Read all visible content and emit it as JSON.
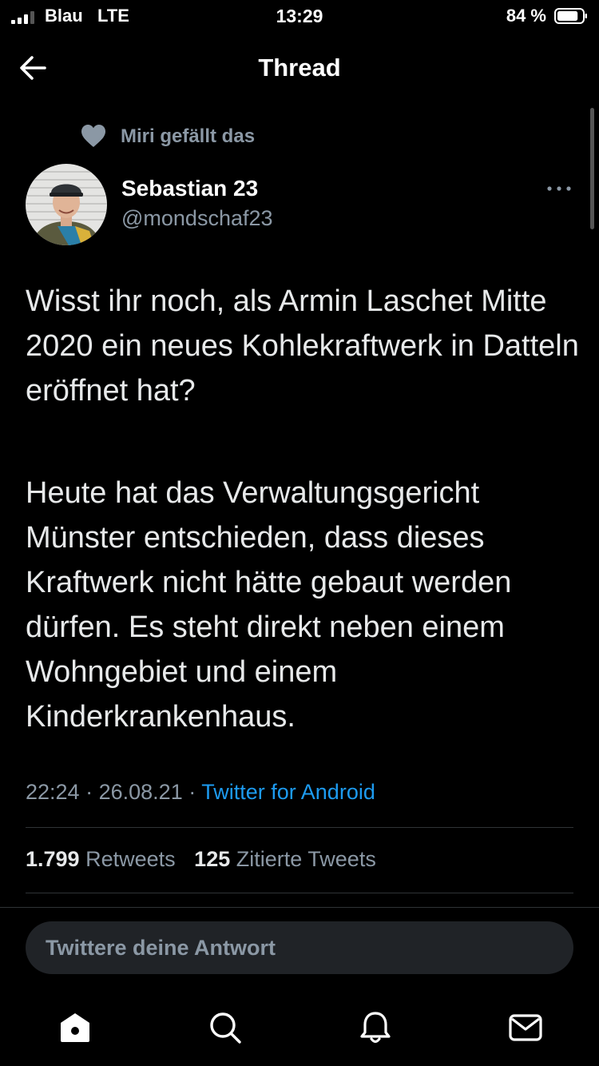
{
  "status_bar": {
    "carrier": "Blau",
    "network": "LTE",
    "time": "13:29",
    "battery_percent": "84 %",
    "signal_icon": "signal-bars-icon",
    "battery_icon": "battery-icon",
    "battery_level": 0.84
  },
  "header": {
    "title": "Thread",
    "back_icon": "back-arrow-icon"
  },
  "tweet": {
    "social_context": "Miri gefällt das",
    "social_icon": "heart-icon",
    "author": {
      "name": "Sebastian 23",
      "handle": "@mondschaf23"
    },
    "more_icon": "more-options-icon",
    "paragraphs": [
      "Wisst ihr noch, als Armin Laschet Mitte 2020 ein neues Kohlekraftwerk in Datteln eröffnet hat?",
      "Heute hat das Verwaltungsgericht Münster entschieden, dass dieses Kraftwerk nicht hätte gebaut werden dürfen. Es steht direkt neben einem Wohngebiet und einem Kinderkrankenhaus."
    ],
    "time": "22:24",
    "date": "26.08.21",
    "separator": "·",
    "source": "Twitter for Android",
    "stats": {
      "retweets_count": "1.799",
      "retweets_label": "Retweets",
      "quotes_count": "125",
      "quotes_label": "Zitierte Tweets"
    }
  },
  "reply": {
    "placeholder": "Twittere deine Antwort"
  },
  "tab_bar": {
    "tabs": [
      "home-icon",
      "search-icon",
      "notifications-bell-icon",
      "messages-mail-icon"
    ]
  },
  "colors": {
    "background": "#000000",
    "text": "#e7e9ea",
    "secondary": "#8b98a5",
    "accent": "#1d9bf0",
    "divider": "#2f3336"
  }
}
